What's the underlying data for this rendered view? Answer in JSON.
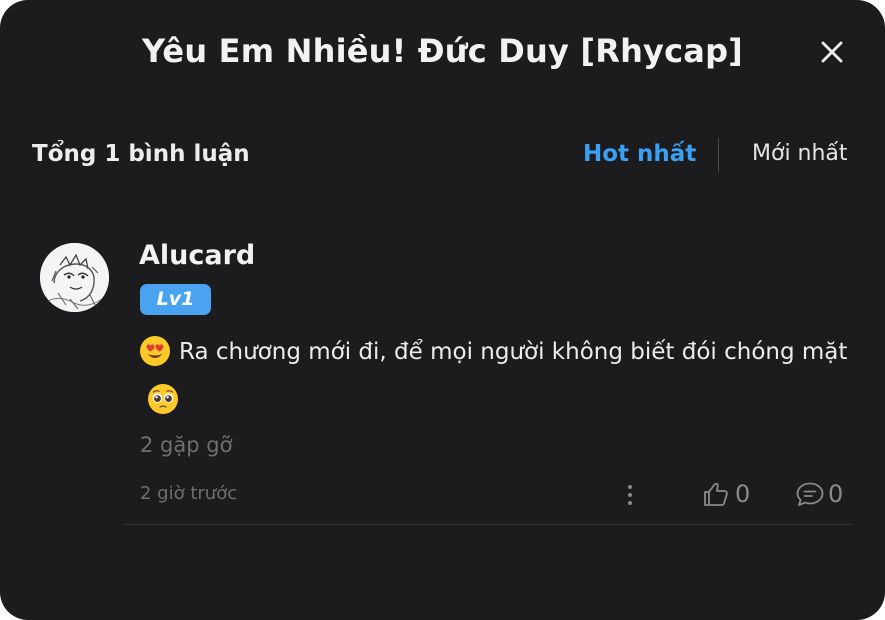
{
  "header": {
    "title": "Yêu Em Nhiều! Đức Duy [Rhycap]",
    "close_icon": "close-icon"
  },
  "summary": {
    "total_label": "Tổng 1 bình luận",
    "sort_hot_label": "Hot nhất",
    "sort_new_label": "Mới nhất",
    "active_sort": "Hot nhất"
  },
  "comments": [
    {
      "username": "Alucard",
      "level": "Lv1",
      "avatar_icon": "manga-sketch-avatar",
      "text_emoji_start": "heart-eyes-emoji",
      "text": "Ra chương mới đi, để mọi người không biết đói chóng mặt",
      "text_emoji_end": "pleading-face-emoji",
      "encounters": "2 gặp gỡ",
      "timestamp": "2 giờ trước",
      "likes": "0",
      "replies": "0",
      "more_icon": "more-vertical-icon",
      "like_icon": "thumbs-up-icon",
      "reply_icon": "comment-bubble-icon"
    }
  ],
  "colors": {
    "background": "#1c1c1e",
    "accent": "#3aa0f2",
    "badge": "#4aa3f0",
    "muted_text": "#6f6f73"
  }
}
